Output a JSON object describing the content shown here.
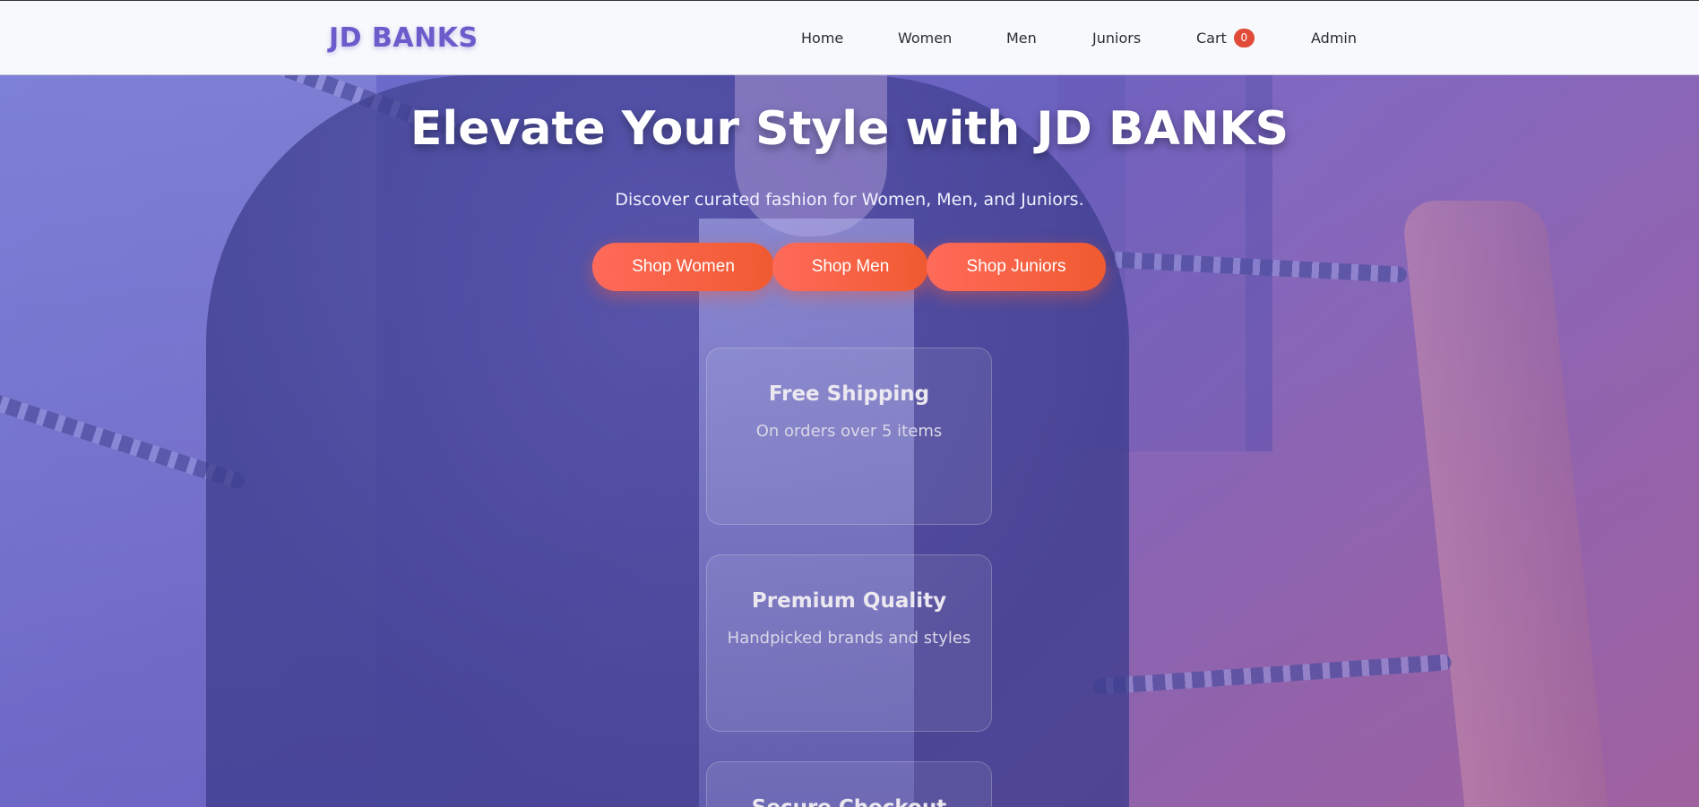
{
  "brand": {
    "name": "JD BANKS",
    "color": "#6b5ccc"
  },
  "nav": {
    "items": [
      {
        "label": "Home"
      },
      {
        "label": "Women"
      },
      {
        "label": "Men"
      },
      {
        "label": "Juniors"
      },
      {
        "label": "Cart",
        "badge": "0"
      },
      {
        "label": "Admin"
      }
    ]
  },
  "hero": {
    "title": "Elevate Your Style with JD BANKS",
    "subtitle": "Discover curated fashion for Women, Men, and Juniors.",
    "buttons": [
      {
        "label": "Shop Women"
      },
      {
        "label": "Shop Men"
      },
      {
        "label": "Shop Juniors"
      }
    ]
  },
  "features": [
    {
      "title": "Free Shipping",
      "text": "On orders over 5 items"
    },
    {
      "title": "Premium Quality",
      "text": "Handpicked brands and styles"
    },
    {
      "title": "Secure Checkout",
      "text": ""
    }
  ],
  "colors": {
    "accent": "#f05a30",
    "badge": "#e04b3a",
    "overlay": "#6b6fcf"
  }
}
